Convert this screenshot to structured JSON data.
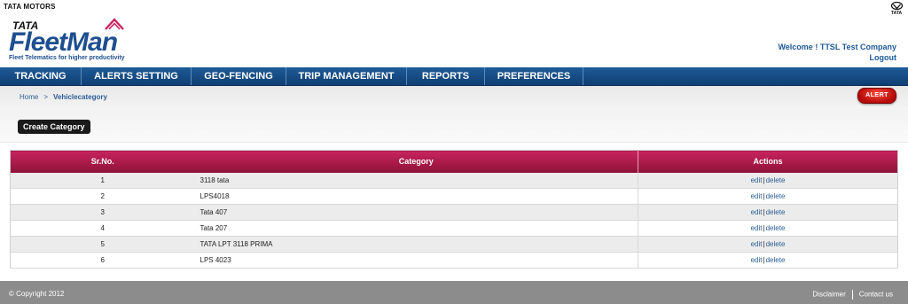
{
  "header": {
    "brand_text": "TATA MOTORS",
    "corner_logo_label": "TATA",
    "logo": {
      "tata": "TATA",
      "fleet": "Fleet",
      "man": "Man",
      "tagline": "Fleet Telematics for higher productivity"
    },
    "welcome": "Welcome ! TTSL Test Company",
    "logout": "Logout"
  },
  "nav": [
    {
      "label": "TRACKING"
    },
    {
      "label": "ALERTS SETTING"
    },
    {
      "label": "GEO-FENCING"
    },
    {
      "label": "TRIP MANAGEMENT"
    },
    {
      "label": "REPORTS"
    },
    {
      "label": "PREFERENCES"
    }
  ],
  "breadcrumb": {
    "home": "Home",
    "separator": ">",
    "current": "Vehiclecategory"
  },
  "alert_button": "ALERT",
  "create_button": "Create Category",
  "table": {
    "columns": [
      "Sr.No.",
      "Category",
      "Actions"
    ],
    "rows": [
      {
        "sr": "1",
        "category": "3118 tata",
        "edit": "edit",
        "delete": "delete"
      },
      {
        "sr": "2",
        "category": "LPS4018",
        "edit": "edit",
        "delete": "delete"
      },
      {
        "sr": "3",
        "category": "Tata 407",
        "edit": "edit",
        "delete": "delete"
      },
      {
        "sr": "4",
        "category": "Tata 207",
        "edit": "edit",
        "delete": "delete"
      },
      {
        "sr": "5",
        "category": "TATA LPT 3118 PRIMA",
        "edit": "edit",
        "delete": "delete"
      },
      {
        "sr": "6",
        "category": "LPS 4023",
        "edit": "edit",
        "delete": "delete"
      }
    ]
  },
  "footer": {
    "copyright": "© Copyright 2012",
    "disclaimer": "Disclaimer",
    "contact": "Contact us"
  },
  "colors": {
    "nav_blue": "#1e5c97",
    "header_crimson": "#c8245e",
    "link_blue": "#2a5d95",
    "alert_red": "#d61c1c",
    "footer_gray": "#8c8c8c"
  }
}
